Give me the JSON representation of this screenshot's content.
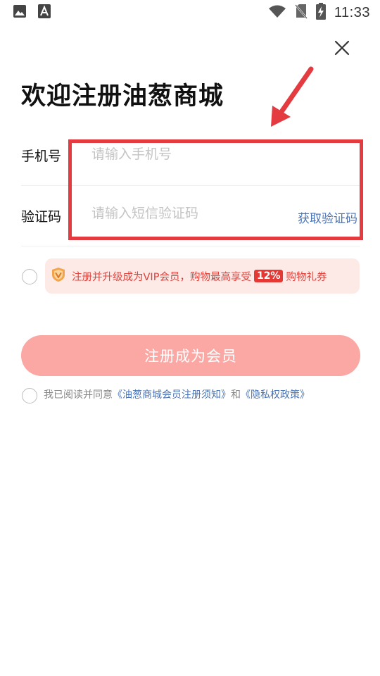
{
  "status_bar": {
    "time": "11:33",
    "icons": [
      "image-icon",
      "font-icon",
      "wifi-icon",
      "no-sim-icon",
      "battery-charging-icon"
    ]
  },
  "title": "欢迎注册油葱商城",
  "phone": {
    "label": "手机号",
    "placeholder": "请输入手机号",
    "value": ""
  },
  "code": {
    "label": "验证码",
    "placeholder": "请输入短信验证码",
    "value": "",
    "get_code_label": "获取验证码"
  },
  "vip": {
    "text_before": "注册并升级成为VIP会员，购物最高享受",
    "badge": "12%",
    "text_after": "购物礼券",
    "checked": false
  },
  "register_button": "注册成为会员",
  "agreement": {
    "prefix": "我已阅读并同意",
    "link1": "《油葱商城会员注册须知》",
    "and": "和",
    "link2": "《隐私权政策》",
    "checked": false
  },
  "colors": {
    "accent_red": "#e2413b",
    "button_pink": "#fba7a3",
    "link_blue": "#4a74b5",
    "highlight_red": "#e33b3f"
  }
}
